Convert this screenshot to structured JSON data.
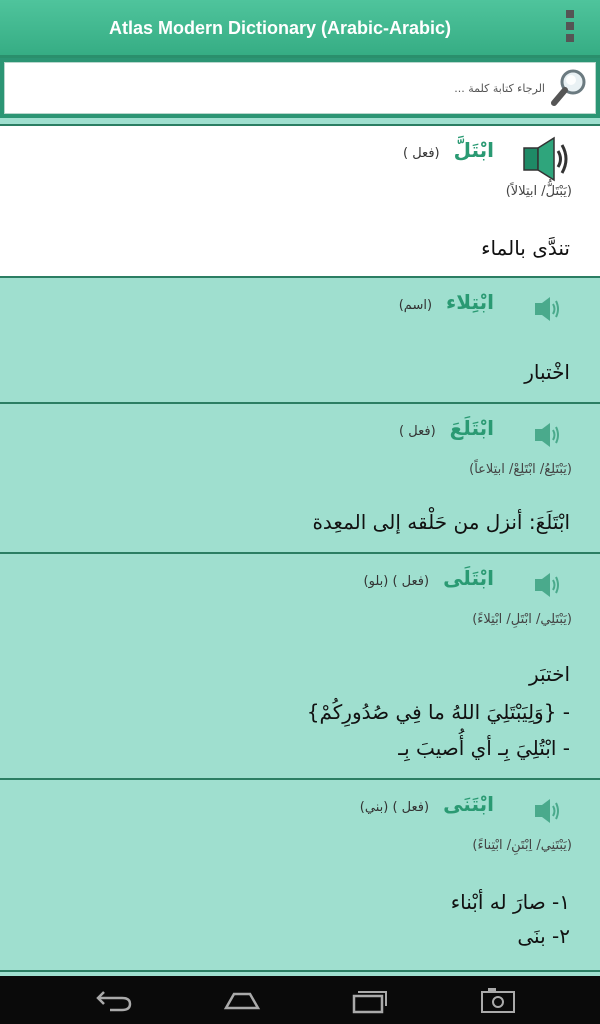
{
  "app": {
    "title": "Atlas Modern Dictionary (Arabic-Arabic)"
  },
  "search": {
    "placeholder": "الرجاء كتابة كلمة ...",
    "value": ""
  },
  "entries": [
    {
      "headword": "ابْتَلَّ",
      "pos": "(فعل )",
      "forms": "(يَبْتَلُّ/  ابتِلالاً)",
      "definition": [
        "تندَّى بالماء"
      ],
      "selected": true
    },
    {
      "headword": "ابْتِلاء",
      "pos": "(اسم)",
      "forms": "",
      "definition": [
        "اخْتبار"
      ]
    },
    {
      "headword": "ابْتَلَعَ",
      "pos": "(فعل )",
      "forms": "(يَبْتَلِعُ/  ابْتَلِعْ/  ابتِلاعاً)",
      "definition": [
        "ابْتَلَعَ: أنزل من حَلْقه إلى المعِدة"
      ]
    },
    {
      "headword": "ابْتَلَى",
      "pos": "(فعل ) (بلو)",
      "forms": "(يَبْتَلِي/  ابْتَلِ/  ابْتِلاءً)",
      "definition": [
        "اختبَر",
        "- {وَلِيَبْتَلِيَ اللهُ ما فِي صُدُورِكُمْ}",
        "- ابْتُلِيَ بِـ أي أُصيبَ بِـ"
      ]
    },
    {
      "headword": "ابْتَنَى",
      "pos": "(فعل ) (بني)",
      "forms": "(يَبْتَنِي/  اِبْتَنِ/  ابْتِناءً)",
      "definition": [
        "١- صارَ له أبْناء",
        "٢- بنَى"
      ]
    }
  ],
  "navbar": {
    "buttons": [
      "back-icon",
      "home-icon",
      "recent-apps-icon",
      "screenshot-icon"
    ]
  }
}
